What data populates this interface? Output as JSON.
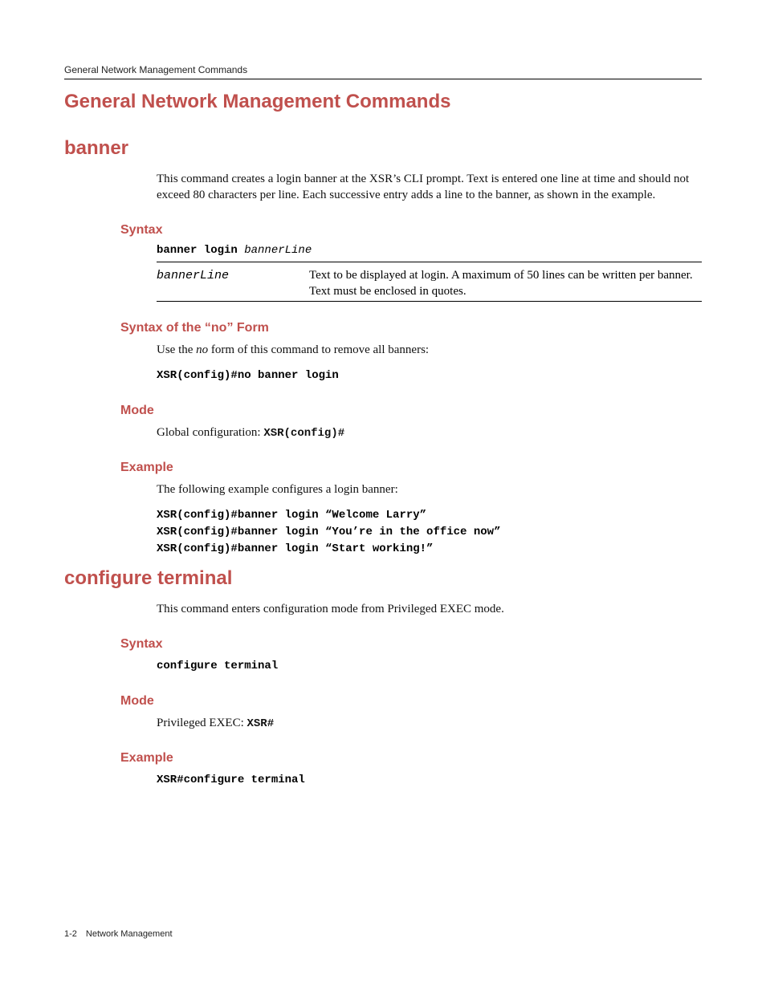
{
  "header": "General Network Management Commands",
  "section_title": "General Network Management Commands",
  "banner": {
    "title": "banner",
    "intro": "This command creates a login banner at the XSR’s CLI prompt. Text is entered one line at time and should not exceed 80 characters per line. Each successive entry adds a line to the banner, as shown in the example.",
    "syntax_heading": "Syntax",
    "syntax_cmd": "banner login ",
    "syntax_arg": "bannerLine",
    "param_name": "bannerLine",
    "param_desc": "Text to be displayed at login. A maximum of 50 lines can be written per banner. Text must be enclosed in quotes.",
    "noform_heading": "Syntax of the “no” Form",
    "noform_text_1": "Use the ",
    "noform_text_italic": "no",
    "noform_text_2": " form of this command to remove all banners:",
    "noform_code": "XSR(config)#no banner login",
    "mode_heading": "Mode",
    "mode_text": "Global configuration: ",
    "mode_code": "XSR(config)#",
    "example_heading": "Example",
    "example_text": "The following example configures a login banner:",
    "example_code": "XSR(config)#banner login “Welcome Larry”\nXSR(config)#banner login “You’re in the office now”\nXSR(config)#banner login “Start working!”"
  },
  "configure": {
    "title": "configure terminal",
    "intro": "This command enters configuration mode from Privileged EXEC mode.",
    "syntax_heading": "Syntax",
    "syntax_code": "configure terminal",
    "mode_heading": "Mode",
    "mode_text": "Privileged EXEC: ",
    "mode_code": "XSR#",
    "example_heading": "Example",
    "example_code": "XSR#configure terminal"
  },
  "footer": "1-2 Network Management"
}
